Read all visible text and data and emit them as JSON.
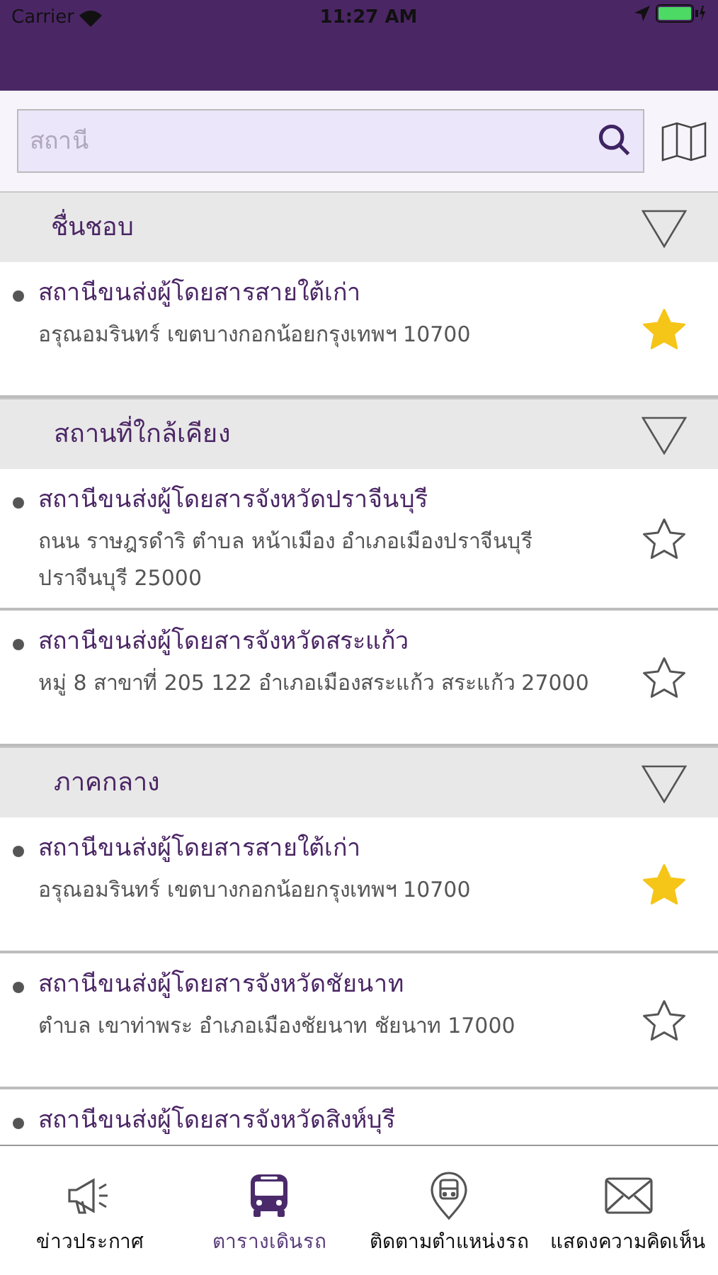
{
  "status_bar": {
    "carrier": "Carrier",
    "time": "11:27 AM"
  },
  "search": {
    "placeholder": "สถานี"
  },
  "sections": [
    {
      "title": "ชื่นชอบ",
      "expanded": true,
      "items": [
        {
          "name": "สถานีขนส่งผู้โดยสารสายใต้เก่า",
          "address": "อรุณอมรินทร์ เขตบางกอกน้อยกรุงเทพฯ 10700",
          "favorite": true
        }
      ]
    },
    {
      "title": "สถานที่ใกล้เคียง",
      "expanded": true,
      "items": [
        {
          "name": "สถานีขนส่งผู้โดยสารจังหวัดปราจีนบุรี",
          "address": "ถนน ราษฎรดำริ ตำบล หน้าเมือง อำเภอเมืองปราจีนบุรี ปราจีนบุรี 25000",
          "favorite": false
        },
        {
          "name": "สถานีขนส่งผู้โดยสารจังหวัดสระแก้ว",
          "address": "หมู่ 8 สาขาที่ 205 122 อำเภอเมืองสระแก้ว สระแก้ว 27000",
          "favorite": false
        }
      ]
    },
    {
      "title": "ภาคกลาง",
      "expanded": true,
      "items": [
        {
          "name": "สถานีขนส่งผู้โดยสารสายใต้เก่า",
          "address": "อรุณอมรินทร์ เขตบางกอกน้อยกรุงเทพฯ 10700",
          "favorite": true
        },
        {
          "name": "สถานีขนส่งผู้โดยสารจังหวัดชัยนาท",
          "address": "ตำบล เขาท่าพระ อำเภอเมืองชัยนาท ชัยนาท 17000",
          "favorite": false
        },
        {
          "name": "สถานีขนส่งผู้โดยสารจังหวัดสิงห์บุรี"
        }
      ]
    }
  ],
  "tab_bar": [
    {
      "kind": "news",
      "label": "ข่าวประกาศ",
      "selected": false
    },
    {
      "kind": "schedule",
      "label": "ตารางเดินรถ",
      "selected": true
    },
    {
      "kind": "tracking",
      "label": "ติดตามตำแหน่งรถ",
      "selected": false
    },
    {
      "kind": "feedback",
      "label": "แสดงความคิดเห็น",
      "selected": false
    }
  ]
}
